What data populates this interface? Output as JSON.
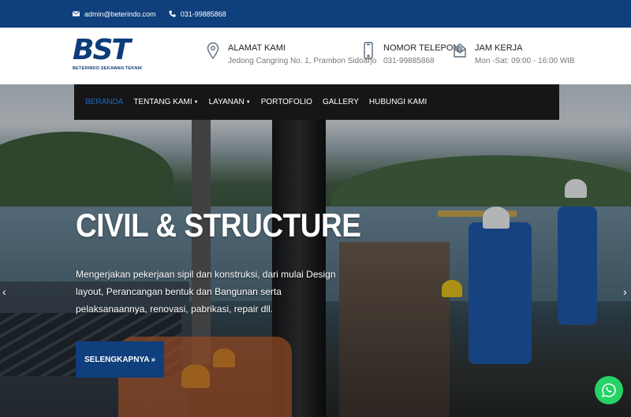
{
  "topbar": {
    "email": "admin@beterindo.com",
    "phone": "031-99885868",
    "email_icon": "envelope-icon",
    "phone_icon": "phone-icon"
  },
  "brand": {
    "logo_text": "BST",
    "logo_sub": "BETERINDO SEKAWAN TEKNIK",
    "color": "#0d3c7a"
  },
  "header_info": [
    {
      "icon": "map-pin-icon",
      "title": "ALAMAT KAMI",
      "sub": "Jedong Cangring No. 1, Prambon Sidoarjo"
    },
    {
      "icon": "mobile-phone-icon",
      "title": "NOMOR TELEPON",
      "sub": "031-99885868"
    },
    {
      "icon": "mail-clock-icon",
      "title": "JAM KERJA",
      "sub": "Mon -Sat: 09:00 - 16:00 WIB"
    }
  ],
  "nav": {
    "items": [
      {
        "label": "BERANDA",
        "active": true
      },
      {
        "label": "TENTANG KAMI",
        "dropdown": true
      },
      {
        "label": "LAYANAN",
        "dropdown": true
      },
      {
        "label": "PORTOFOLIO"
      },
      {
        "label": "GALLERY"
      },
      {
        "label": "HUBUNGI KAMI"
      }
    ]
  },
  "hero": {
    "title": "CIVIL & STRUCTURE",
    "description": "Mengerjakan pekerjaan sipil dan konstruksi, dari mulai Design layout, Perancangan bentuk dan Bangunan serta pelaksanaannya, renovasi, pabrikasi, repair dll.",
    "button_label": "SELENGKAPNYA",
    "button_suffix": "»",
    "prev": "‹",
    "next": "›"
  },
  "colors": {
    "primary": "#0f3f7c",
    "nav_bg": "#161616",
    "nav_active": "#1a67c8",
    "whatsapp": "#25d366"
  },
  "whatsapp_icon": "whatsapp-icon"
}
